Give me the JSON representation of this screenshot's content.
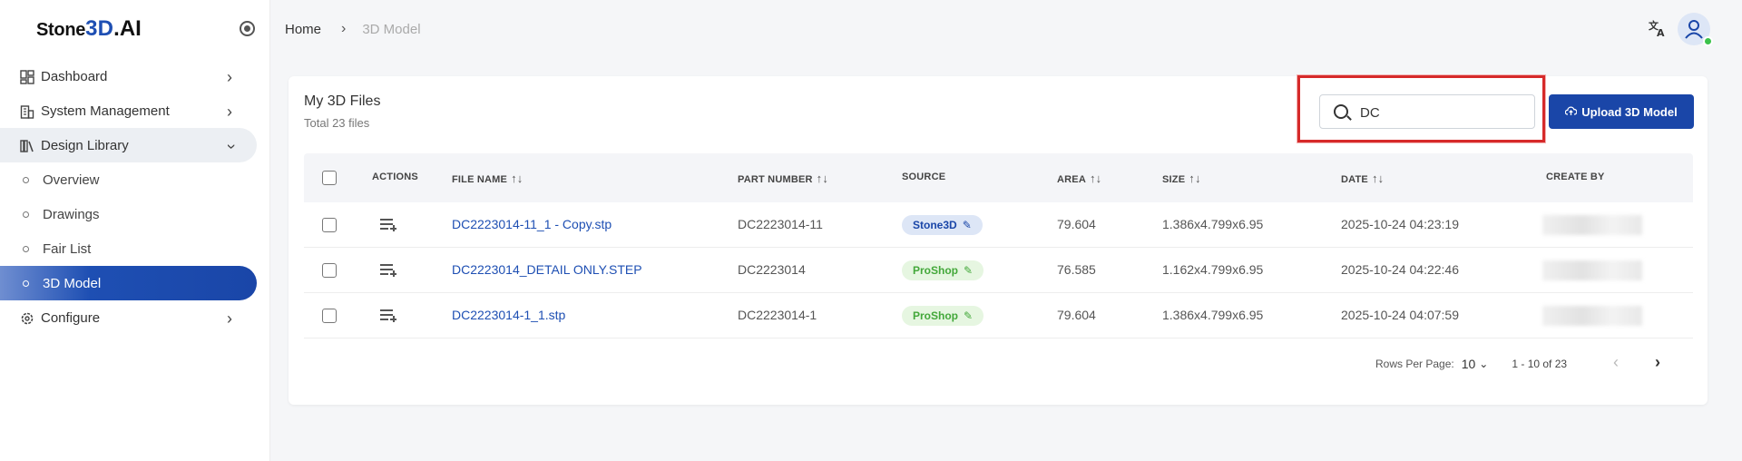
{
  "brand": {
    "part1": "Stone",
    "part2": "3D",
    "part3": ".AI"
  },
  "sidebar": {
    "items": [
      {
        "label": "Dashboard"
      },
      {
        "label": "System Management"
      },
      {
        "label": "Design Library"
      },
      {
        "label": "Overview"
      },
      {
        "label": "Drawings"
      },
      {
        "label": "Fair List"
      },
      {
        "label": "3D Model"
      },
      {
        "label": "Configure"
      }
    ]
  },
  "breadcrumb": {
    "home": "Home",
    "current": "3D Model"
  },
  "card": {
    "title": "My 3D Files",
    "subtitle": "Total 23 files"
  },
  "search": {
    "value": "DC"
  },
  "upload": {
    "label": "Upload 3D Model"
  },
  "table": {
    "headers": {
      "actions": "ACTIONS",
      "file_name": "FILE NAME",
      "part_number": "PART NUMBER",
      "source": "SOURCE",
      "area": "AREA",
      "size": "SIZE",
      "date": "DATE",
      "create_by": "CREATE BY"
    },
    "rows": [
      {
        "file_name": "DC2223014-11_1 - Copy.stp",
        "part_number": "DC2223014-11",
        "source": "Stone3D",
        "area": "79.604",
        "size": "1.386x4.799x6.95",
        "date": "2025-10-24 04:23:19"
      },
      {
        "file_name": "DC2223014_DETAIL ONLY.STEP",
        "part_number": "DC2223014",
        "source": "ProShop",
        "area": "76.585",
        "size": "1.162x4.799x6.95",
        "date": "2025-10-24 04:22:46"
      },
      {
        "file_name": "DC2223014-1_1.stp",
        "part_number": "DC2223014-1",
        "source": "ProShop",
        "area": "79.604",
        "size": "1.386x4.799x6.95",
        "date": "2025-10-24 04:07:59"
      }
    ]
  },
  "pagination": {
    "rows_per_page_label": "Rows Per Page:",
    "rows_per_page": "10",
    "range": "1 - 10 of 23"
  },
  "colors": {
    "primary": "#1a46a8",
    "highlight": "#d62a2a",
    "stone3d_badge": "#dde6f6",
    "proshop_badge": "#e6f6e1"
  }
}
